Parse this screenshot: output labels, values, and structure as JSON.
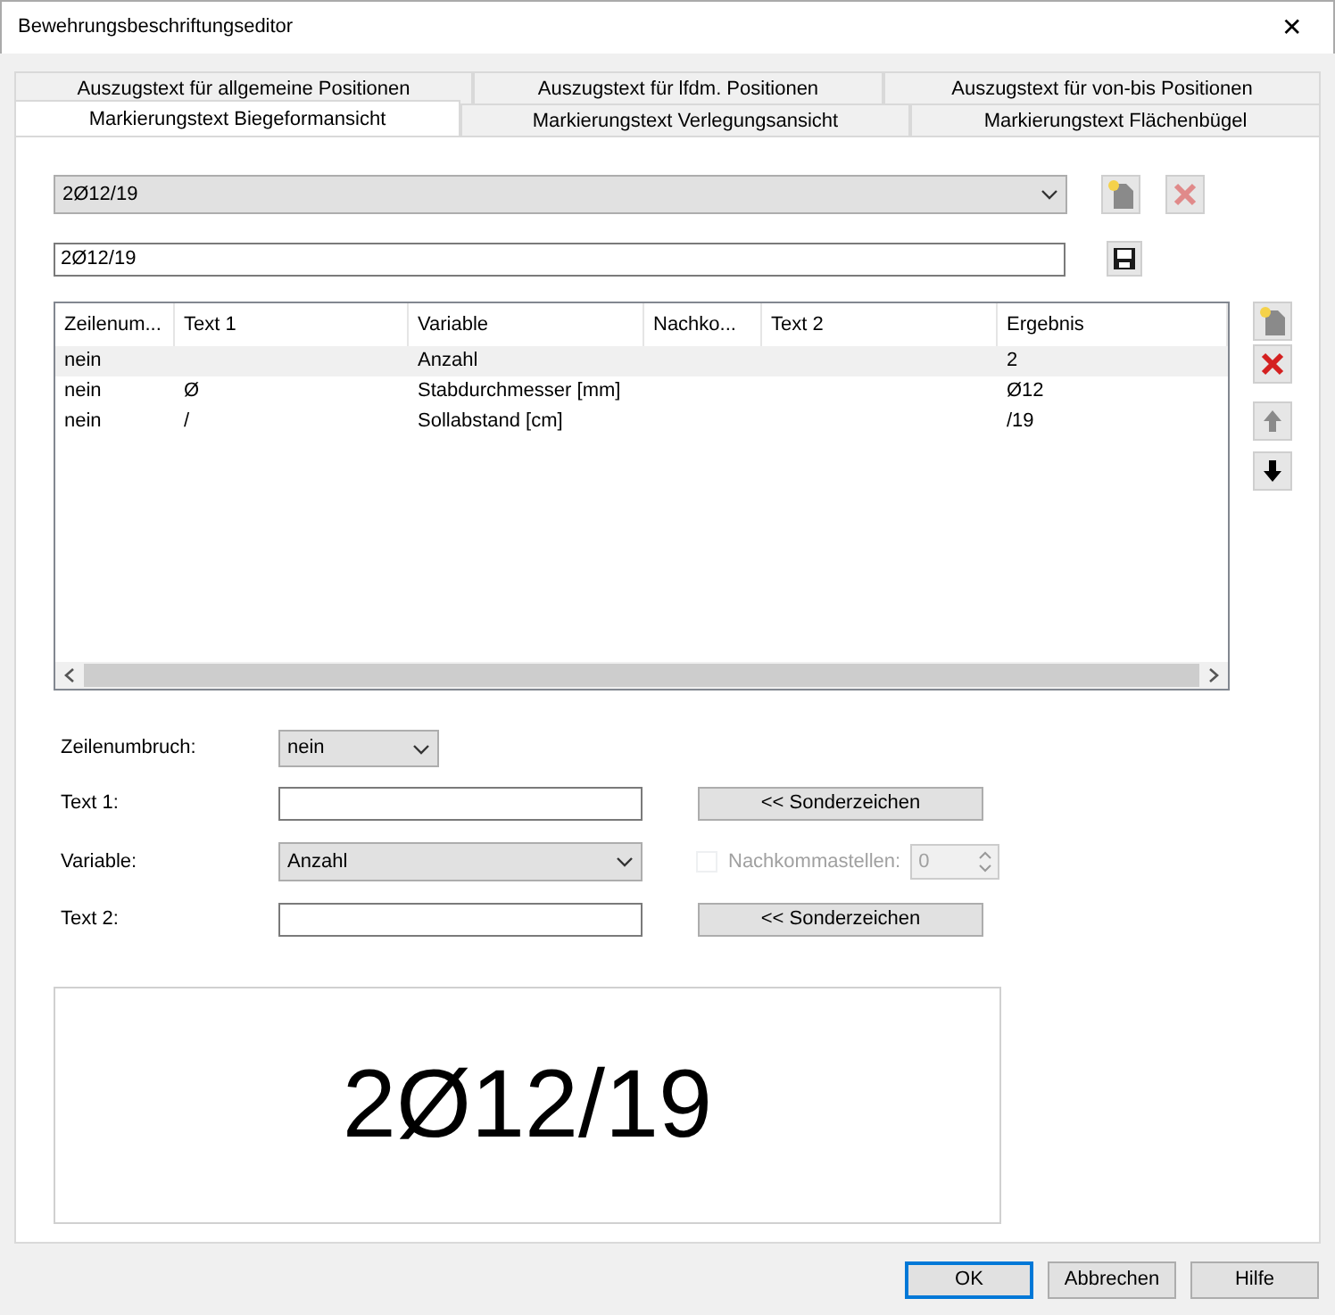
{
  "window": {
    "title": "Bewehrungsbeschriftungseditor",
    "close": "✕"
  },
  "tab_rows": [
    [
      {
        "label": "Auszugstext für allgemeine Positionen",
        "selected": false
      },
      {
        "label": "Auszugstext für lfdm. Positionen",
        "selected": false
      },
      {
        "label": "Auszugstext für von-bis Positionen",
        "selected": false
      }
    ],
    [
      {
        "label": "Markierungstext Biegeformansicht",
        "selected": true
      },
      {
        "label": "Markierungstext Verlegungsansicht",
        "selected": false
      },
      {
        "label": "Markierungstext Flächenbügel",
        "selected": false
      }
    ]
  ],
  "preset_combo": {
    "value": "2Ø12/19",
    "delete_disabled": true
  },
  "text_field": {
    "value": "2Ø12/19"
  },
  "table": {
    "columns": [
      "Zeilenum...",
      "Text 1",
      "Variable",
      "Nachko...",
      "Text 2",
      "Ergebnis"
    ],
    "rows": [
      {
        "cells": [
          "nein",
          null,
          "Anzahl",
          null,
          null,
          "2"
        ],
        "selected": true
      },
      {
        "cells": [
          "nein",
          "Ø",
          "Stabdurchmesser [mm]",
          null,
          null,
          "Ø12"
        ],
        "selected": false
      },
      {
        "cells": [
          "nein",
          "/",
          "Sollabstand [cm]",
          null,
          null,
          "/19"
        ],
        "selected": false
      }
    ],
    "up_disabled": true,
    "down_disabled": false
  },
  "form": {
    "zeilenumbruch_label": "Zeilenumbruch:",
    "zeilenumbruch_value": "nein",
    "text1_label": "Text 1:",
    "sonderzeichen_1": "<< Sonderzeichen",
    "variable_label": "Variable:",
    "variable_value": "Anzahl",
    "decimals_label": "Nachkommastellen:",
    "decimals_checked": false,
    "decimals_disabled": true,
    "decimals_value": "0",
    "text2_label": "Text 2:",
    "sonderzeichen_2": "<< Sonderzeichen"
  },
  "preview": {
    "text": "2Ø12/19"
  },
  "buttons": [
    {
      "label": "OK",
      "default": true
    },
    {
      "label": "Abbrechen",
      "default": false
    },
    {
      "label": "Hilfe",
      "default": false
    }
  ]
}
